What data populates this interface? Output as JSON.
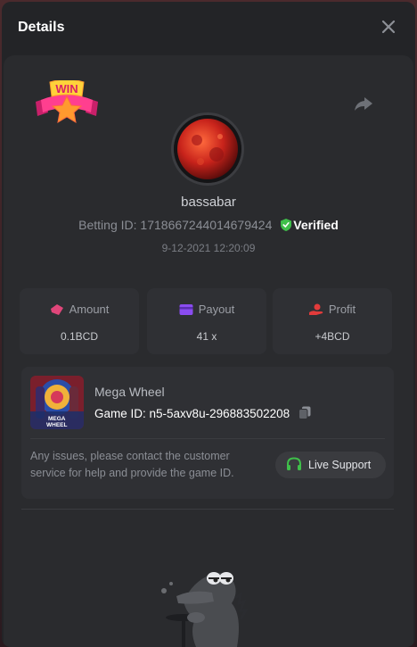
{
  "modal": {
    "title": "Details"
  },
  "badge": {
    "text": "WIN"
  },
  "player": {
    "username": "bassabar",
    "betting_id_label": "Betting ID:",
    "betting_id": "1718667244014679424",
    "verified_label": "Verified",
    "timestamp": "9-12-2021 12:20:09"
  },
  "stats": [
    {
      "label": "Amount",
      "value": "0.1BCD",
      "icon": "amount-icon",
      "color": "#e0467a"
    },
    {
      "label": "Payout",
      "value": "41 x",
      "icon": "wallet-icon",
      "color": "#8a4cf0"
    },
    {
      "label": "Profit",
      "value": "+4BCD",
      "icon": "profit-icon",
      "color": "#e23b3b"
    }
  ],
  "game": {
    "name": "Mega Wheel",
    "id_label": "Game ID:",
    "id": "n5-5axv8u-296883502208",
    "thumb_text": "MEGA WHEEL"
  },
  "support": {
    "message": "Any issues, please contact the customer service for help and provide the game ID.",
    "button_label": "Live Support"
  },
  "colors": {
    "accent_green": "#3fbf4a",
    "panel": "#2a2b2e",
    "card": "#2f3034"
  }
}
